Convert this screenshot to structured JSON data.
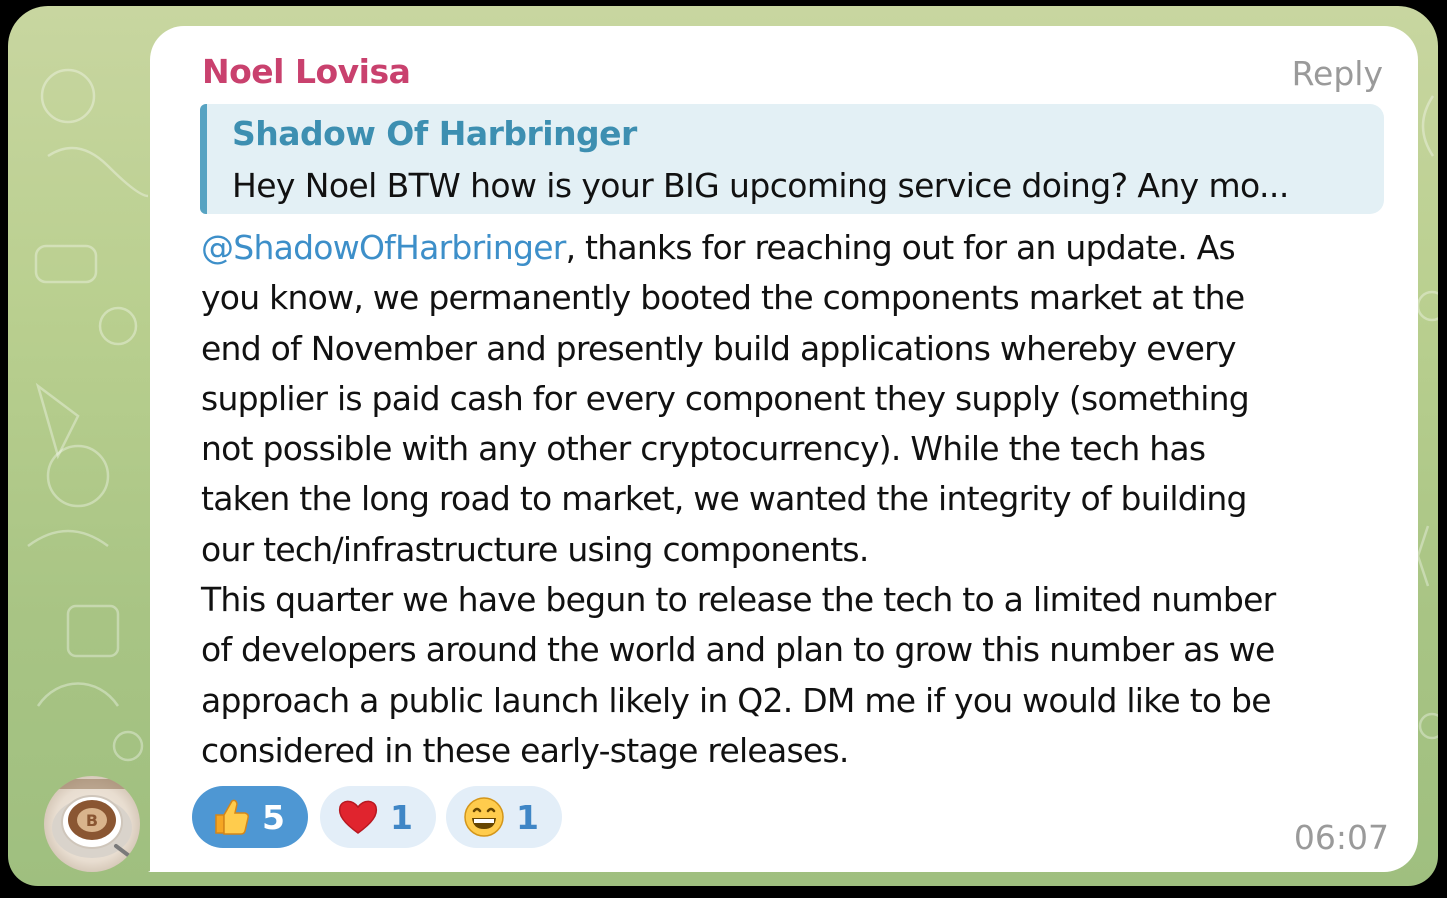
{
  "message": {
    "sender": "Noel Lovisa",
    "reply_label": "Reply",
    "quoted": {
      "author": "Shadow Of Harbringer",
      "text": "Hey Noel  BTW how is your BIG upcoming service doing? Any mo..."
    },
    "mention": "@ShadowOfHarbringer",
    "body_lines": [
      ", thanks for reaching out for an update. As",
      "you know, we permanently booted the components market at the",
      "end of November and presently build applications whereby every",
      "supplier is paid cash for every component they supply (something",
      "not possible with any other cryptocurrency). While the tech has",
      "taken the long road to market, we wanted the integrity of building",
      "our tech/infrastructure using components.",
      "This quarter we have begun to release the tech to a limited number",
      "of developers around the world and plan to grow this number as we",
      "approach a public launch likely in Q2. DM me if you would like to be",
      "considered in these early-stage releases."
    ],
    "timestamp": "06:07"
  },
  "reactions": [
    {
      "emoji": "thumbs-up-icon",
      "count": "5",
      "active": true
    },
    {
      "emoji": "red-heart-icon",
      "count": "1",
      "active": false
    },
    {
      "emoji": "grinning-face-icon",
      "count": "1",
      "active": false
    }
  ],
  "colors": {
    "sender_name": "#c9416e",
    "quote_author": "#3d8fb1",
    "mention": "#3d8fc9",
    "reaction_active": "#4e97d3",
    "reaction_inactive": "#e3eef8",
    "chat_background": "#b9cf8f"
  }
}
